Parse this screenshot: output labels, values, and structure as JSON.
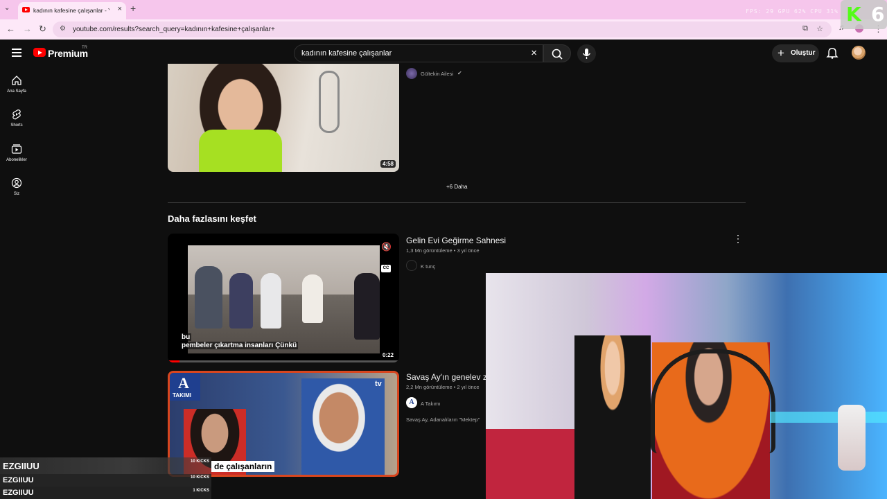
{
  "browser": {
    "tab_title": "kadının kafesine çalışanlar - You",
    "new_tab_symbol": "+",
    "url": "youtube.com/results?search_query=kadının+kafesine+çalışanlar+",
    "sys_stats": "FPS: 29   GPU 62%   CPU 31%"
  },
  "stream_logo": {
    "letter": "K",
    "number": "6"
  },
  "masthead": {
    "brand": "Premium",
    "country": "TR",
    "search_value": "kadının kafesine çalışanlar",
    "create_label": "Oluştur"
  },
  "sidebar": {
    "items": [
      {
        "label": "Ana Sayfa",
        "icon": "home-icon"
      },
      {
        "label": "Shorts",
        "icon": "shorts-icon"
      },
      {
        "label": "Abonelikler",
        "icon": "subscriptions-icon"
      },
      {
        "label": "Siz",
        "icon": "you-icon"
      }
    ]
  },
  "results": {
    "first": {
      "channel": "Gültekin Ailesi",
      "duration": "4:58"
    },
    "more_label": "+6 Daha",
    "section_title": "Daha fazlasını keşfet",
    "videos": [
      {
        "title": "Gelin Evi Geğirme Sahnesi",
        "meta": "1,3 Mn görüntüleme • 3 yıl önce",
        "channel": "K tunç",
        "duration": "0:22",
        "caption_line1": "bu",
        "caption_line2": "pembeler çıkartma insanları Çünkü",
        "cc_label": "CC"
      },
      {
        "title": "Savaş Ay'ın genelev z",
        "meta": "2,2 Mn görüntüleme • 2 yıl önce",
        "channel": "A Takımı",
        "description": "Savaş Ay, Adanalıların \"Mektep\"",
        "thumb_logo": "TAKIMI",
        "thumb_logo_letter": "A",
        "thumb_caption": "de çalışanların",
        "thumb_tv": "tv"
      }
    ]
  },
  "kicks": {
    "rows": [
      {
        "name": "EZGIIUU",
        "count": "10 KICKS"
      },
      {
        "name": "EZGIIUU",
        "count": "10 KICKS"
      },
      {
        "name": "EZGIIUU",
        "count": "1 KICKS"
      }
    ]
  },
  "colors": {
    "yt_red": "#ff0000",
    "kick_green": "#53fc18",
    "tab_pink": "#f6c6ec"
  }
}
